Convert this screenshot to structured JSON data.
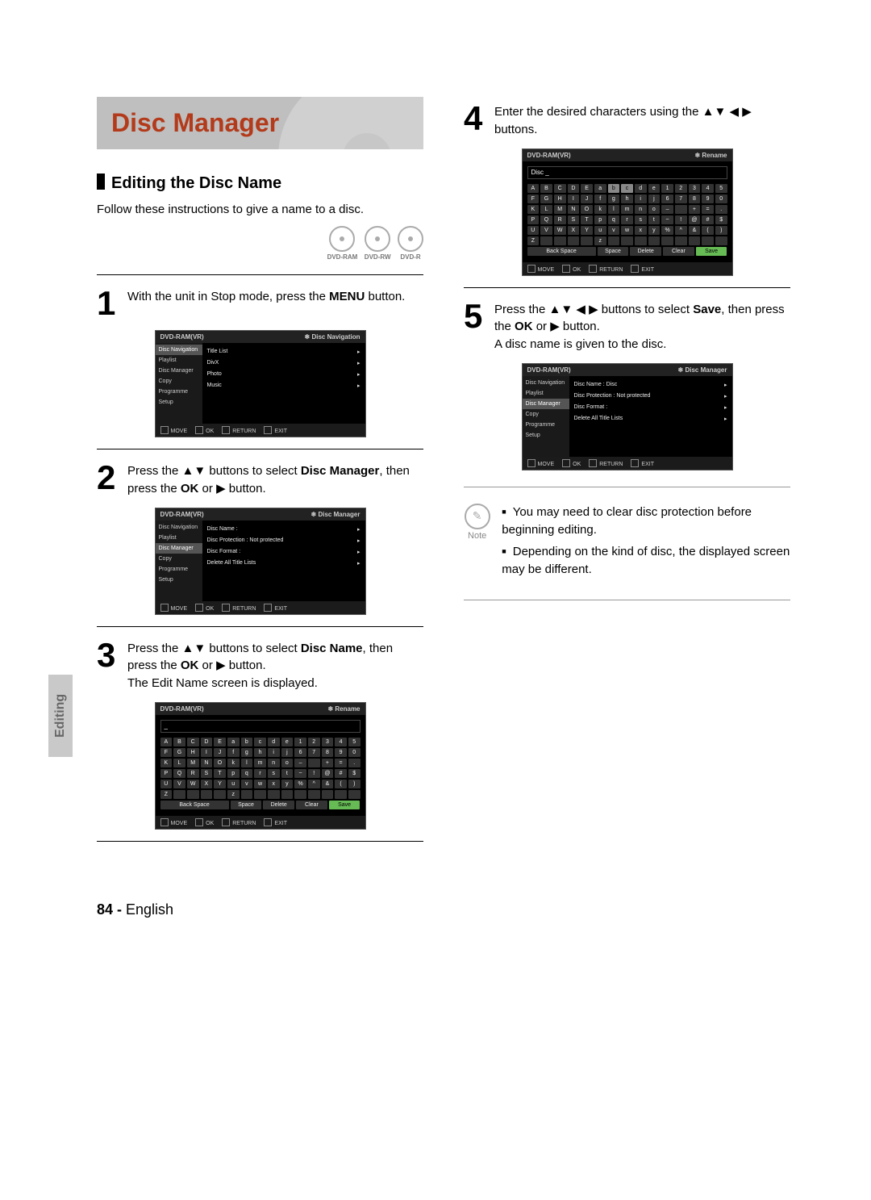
{
  "title": "Disc Manager",
  "sideTab": "Editing",
  "section": "Editing the Disc Name",
  "intro": "Follow these instructions to give a name to a disc.",
  "badges": [
    "DVD-RAM",
    "DVD-RW",
    "DVD-R"
  ],
  "arrows": {
    "updown": "▲▼",
    "leftright": "◀▶",
    "play": "▶",
    "right": "▸"
  },
  "steps": {
    "s1": {
      "num": "1",
      "pre": "With the unit in Stop mode, press the ",
      "b": "MENU",
      "post": " button."
    },
    "s2": {
      "num": "2",
      "pre": "Press the ",
      "arr": "▲▼",
      "mid1": " buttons to select ",
      "b1": "Disc Manager",
      "mid2": ", then press the ",
      "b2": "OK",
      "mid3": " or ",
      "play": "▶",
      "post": " button."
    },
    "s3": {
      "num": "3",
      "pre": "Press the ",
      "arr": "▲▼",
      "mid1": " buttons to select ",
      "b1": "Disc Name",
      "mid2": ", then press the ",
      "b2": "OK",
      "mid3": " or ",
      "play": "▶",
      "post": " button.",
      "line2": "The Edit Name screen is displayed."
    },
    "s4": {
      "num": "4",
      "pre": "Enter the desired characters using the ",
      "arr": "▲▼ ◀ ▶",
      "post": " buttons."
    },
    "s5": {
      "num": "5",
      "pre": "Press the ",
      "arr": "▲▼ ◀ ▶",
      "mid1": " buttons to select ",
      "b1": "Save",
      "mid2": ", then press the ",
      "b2": "OK",
      "mid3": " or ",
      "play": "▶",
      "post": " button.",
      "line2": "A disc name is given to the disc."
    }
  },
  "osd": {
    "foot": {
      "move": "MOVE",
      "ok": "OK",
      "ret": "RETURN",
      "exit": "EXIT"
    },
    "hdr": "DVD-RAM(VR)",
    "side": [
      "Disc Navigation",
      "Playlist",
      "Disc Manager",
      "Copy",
      "Programme",
      "Setup"
    ],
    "nav": {
      "title": "Disc Navigation",
      "items": [
        "Title List",
        "DivX",
        "Photo",
        "Music"
      ]
    },
    "mgr": {
      "title": "Disc Manager",
      "rows": [
        {
          "l": "Disc Name",
          "v": ":"
        },
        {
          "l": "Disc Protection",
          "v": ": Not protected"
        },
        {
          "l": "Disc Format",
          "v": ":"
        },
        {
          "l": "Delete All Title Lists",
          "v": ""
        }
      ]
    },
    "mgr2": {
      "title": "Disc Manager",
      "rows": [
        {
          "l": "Disc Name",
          "v": ": Disc"
        },
        {
          "l": "Disc Protection",
          "v": ": Not protected"
        },
        {
          "l": "Disc Format",
          "v": ":"
        },
        {
          "l": "Delete All Title Lists",
          "v": ""
        }
      ]
    },
    "rename": {
      "title": "Rename",
      "field_empty": "_",
      "field_disc": "Disc _",
      "upper": [
        [
          "A",
          "B",
          "C",
          "D",
          "E"
        ],
        [
          "F",
          "G",
          "H",
          "I",
          "J"
        ],
        [
          "K",
          "L",
          "M",
          "N",
          "O"
        ],
        [
          "P",
          "Q",
          "R",
          "S",
          "T"
        ],
        [
          "U",
          "V",
          "W",
          "X",
          "Y"
        ],
        [
          "Z",
          "",
          "",
          "",
          ""
        ]
      ],
      "lower": [
        [
          "a",
          "b",
          "c",
          "d",
          "e"
        ],
        [
          "f",
          "g",
          "h",
          "i",
          "j"
        ],
        [
          "k",
          "l",
          "m",
          "n",
          "o"
        ],
        [
          "p",
          "q",
          "r",
          "s",
          "t"
        ],
        [
          "u",
          "v",
          "w",
          "x",
          "y"
        ],
        [
          "z",
          "",
          "",
          "",
          ""
        ]
      ],
      "num": [
        [
          "1",
          "2",
          "3",
          "4",
          "5"
        ],
        [
          "6",
          "7",
          "8",
          "9",
          "0"
        ],
        [
          "–",
          "",
          "+",
          "=",
          "."
        ],
        [
          "~",
          "!",
          "@",
          "#",
          "$"
        ],
        [
          "%",
          "^",
          "&",
          "(",
          ")"
        ],
        [
          "",
          "",
          "",
          "",
          ""
        ]
      ],
      "actions": {
        "back": "Back Space",
        "space": "Space",
        "delete": "Delete",
        "clear": "Clear",
        "save": "Save"
      }
    }
  },
  "note": {
    "label": "Note",
    "items": [
      "You may need to clear disc protection before beginning editing.",
      "Depending on the kind of disc, the displayed screen may be different."
    ]
  },
  "footer": {
    "num": "84 - ",
    "lang": "English"
  }
}
